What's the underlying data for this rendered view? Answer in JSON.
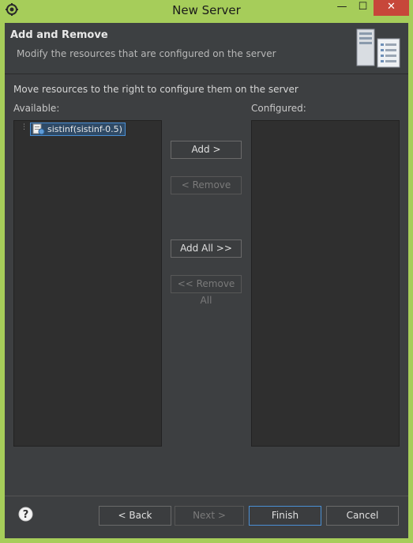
{
  "window": {
    "title": "New Server",
    "minimize": "—",
    "maximize": "☐",
    "close": "✕"
  },
  "banner": {
    "title": "Add and Remove",
    "description": "Modify the resources that are configured on the server",
    "image_icon": "server-icon"
  },
  "main": {
    "instruction": "Move resources to the right to configure them on the server",
    "available_label": "Available:",
    "configured_label": "Configured:",
    "available_items": [
      {
        "label": "sistinf(sistinf-0.5)",
        "icon": "web-module-icon",
        "selected": true
      }
    ],
    "configured_items": []
  },
  "mid_buttons": {
    "add": "Add >",
    "remove": "< Remove",
    "add_all": "Add All >>",
    "remove_all": "<< Remove All"
  },
  "footer": {
    "help_icon": "help-icon",
    "back": "< Back",
    "next": "Next >",
    "finish": "Finish",
    "cancel": "Cancel"
  },
  "colors": {
    "frame_accent": "#a6cd5a",
    "close_button": "#c7473a",
    "selection_border": "#4a8fd4",
    "dialog_background": "#3d3f41"
  }
}
